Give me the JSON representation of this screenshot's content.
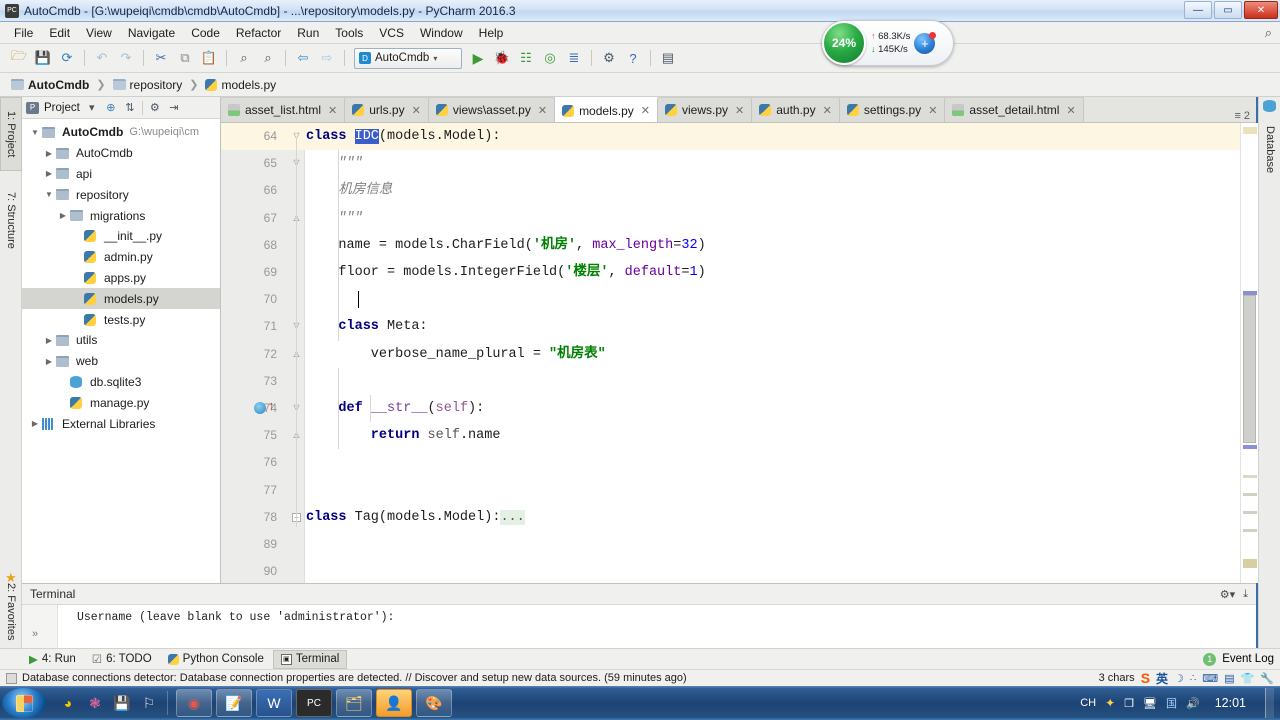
{
  "window": {
    "title": "AutoCmdb - [G:\\wupeiqi\\cmdb\\cmdb\\AutoCmdb] - ...\\repository\\models.py - PyCharm 2016.3",
    "app_icon": "pycharm-icon",
    "minimize_label": "—",
    "maximize_label": "▭",
    "close_label": "✕"
  },
  "menubar": {
    "items": [
      "File",
      "Edit",
      "View",
      "Navigate",
      "Code",
      "Refactor",
      "Run",
      "Tools",
      "VCS",
      "Window",
      "Help"
    ],
    "search_icon": "⌕"
  },
  "toolbar": {
    "buttons": [
      {
        "name": "open-folder-icon",
        "glyph": "🗁",
        "dim": false
      },
      {
        "name": "save-all-icon",
        "glyph": "💾",
        "dim": false
      },
      {
        "name": "sync-icon",
        "glyph": "⟳",
        "dim": false
      },
      {
        "name": "undo-icon",
        "glyph": "↶",
        "dim": true
      },
      {
        "name": "redo-icon",
        "glyph": "↷",
        "dim": true
      },
      {
        "name": "cut-icon",
        "glyph": "✂",
        "dim": false
      },
      {
        "name": "copy-icon",
        "glyph": "⧉",
        "dim": false
      },
      {
        "name": "paste-icon",
        "glyph": "📋",
        "dim": false
      },
      {
        "name": "find-icon",
        "glyph": "⌕",
        "dim": false
      },
      {
        "name": "replace-icon",
        "glyph": "⌕",
        "dim": false
      },
      {
        "name": "back-icon",
        "glyph": "⇦",
        "dim": false
      },
      {
        "name": "forward-icon",
        "glyph": "⇨",
        "dim": true
      }
    ],
    "run_config": {
      "label": "AutoCmdb",
      "icon": "django-icon",
      "caret": "▾"
    },
    "run_buttons": [
      {
        "name": "run-icon",
        "glyph": "▶",
        "color": "#3a9a36"
      },
      {
        "name": "debug-icon",
        "glyph": "🐞",
        "color": "#3a9a36"
      },
      {
        "name": "coverage-icon",
        "glyph": "☲",
        "color": "#3a9a36"
      },
      {
        "name": "profile-icon",
        "glyph": "◎",
        "color": "#3a9a36"
      },
      {
        "name": "attach-icon",
        "glyph": "≣",
        "color": "#2f6fae"
      },
      {
        "name": "settings-icon",
        "glyph": "⚙",
        "color": "#4a5a68"
      },
      {
        "name": "help-icon",
        "glyph": "?",
        "color": "#2f6fae"
      },
      {
        "name": "db-console-icon",
        "glyph": "▤",
        "color": "#4a5a68"
      }
    ]
  },
  "breadcrumb": {
    "items": [
      {
        "label": "AutoCmdb",
        "icon": "folder-icon",
        "bold": true
      },
      {
        "label": "repository",
        "icon": "folder-icon",
        "bold": false
      },
      {
        "label": "models.py",
        "icon": "python-file-icon",
        "bold": false
      }
    ],
    "separator": "❯"
  },
  "left_tool_tabs": [
    {
      "label": "1: Project",
      "selected": true,
      "icon": "project-icon"
    },
    {
      "label": "7: Structure",
      "selected": false,
      "icon": "structure-icon"
    },
    {
      "label": "2: Favorites",
      "selected": false,
      "icon": "star-icon"
    }
  ],
  "right_tool_tabs": [
    {
      "label": "Database",
      "selected": false,
      "icon": "database-icon"
    }
  ],
  "project_panel": {
    "header": {
      "title": "Project",
      "caret": "▾",
      "buttons": [
        "⊕",
        "⇵",
        "⚙",
        "⇥"
      ]
    },
    "tree": [
      {
        "indent": 0,
        "arrow": "▼",
        "icon": "folder-icon",
        "label": "AutoCmdb",
        "bold": true,
        "path": "G:\\wupeiqi\\cm",
        "selected": false
      },
      {
        "indent": 1,
        "arrow": "▶",
        "icon": "folder-icon",
        "label": "AutoCmdb",
        "bold": false,
        "path": "",
        "selected": false
      },
      {
        "indent": 1,
        "arrow": "▶",
        "icon": "folder-icon",
        "label": "api",
        "bold": false,
        "path": "",
        "selected": false
      },
      {
        "indent": 1,
        "arrow": "▼",
        "icon": "folder-icon",
        "label": "repository",
        "bold": false,
        "path": "",
        "selected": false
      },
      {
        "indent": 2,
        "arrow": "▶",
        "icon": "folder-icon",
        "label": "migrations",
        "bold": false,
        "path": "",
        "selected": false
      },
      {
        "indent": 3,
        "arrow": "",
        "icon": "python-file-icon",
        "label": "__init__.py",
        "bold": false,
        "path": "",
        "selected": false
      },
      {
        "indent": 3,
        "arrow": "",
        "icon": "python-file-icon",
        "label": "admin.py",
        "bold": false,
        "path": "",
        "selected": false
      },
      {
        "indent": 3,
        "arrow": "",
        "icon": "python-file-icon",
        "label": "apps.py",
        "bold": false,
        "path": "",
        "selected": false
      },
      {
        "indent": 3,
        "arrow": "",
        "icon": "python-file-icon",
        "label": "models.py",
        "bold": false,
        "path": "",
        "selected": true
      },
      {
        "indent": 3,
        "arrow": "",
        "icon": "python-file-icon",
        "label": "tests.py",
        "bold": false,
        "path": "",
        "selected": false
      },
      {
        "indent": 1,
        "arrow": "▶",
        "icon": "folder-icon",
        "label": "utils",
        "bold": false,
        "path": "",
        "selected": false
      },
      {
        "indent": 1,
        "arrow": "▶",
        "icon": "folder-icon",
        "label": "web",
        "bold": false,
        "path": "",
        "selected": false
      },
      {
        "indent": 2,
        "arrow": "",
        "icon": "database-file-icon",
        "label": "db.sqlite3",
        "bold": false,
        "path": "",
        "selected": false
      },
      {
        "indent": 2,
        "arrow": "",
        "icon": "python-file-icon",
        "label": "manage.py",
        "bold": false,
        "path": "",
        "selected": false
      },
      {
        "indent": 0,
        "arrow": "▶",
        "icon": "library-icon",
        "label": "External Libraries",
        "bold": false,
        "path": "",
        "selected": false
      }
    ]
  },
  "editor_tabs": {
    "tabs": [
      {
        "label": "asset_list.html",
        "icon": "html-file-icon",
        "active": false,
        "close": "✕"
      },
      {
        "label": "urls.py",
        "icon": "python-file-icon",
        "active": false,
        "close": "✕"
      },
      {
        "label": "views\\asset.py",
        "icon": "python-file-icon",
        "active": false,
        "close": "✕"
      },
      {
        "label": "models.py",
        "icon": "python-file-icon",
        "active": true,
        "close": "✕"
      },
      {
        "label": "views.py",
        "icon": "python-file-icon",
        "active": false,
        "close": "✕"
      },
      {
        "label": "auth.py",
        "icon": "python-file-icon",
        "active": false,
        "close": "✕"
      },
      {
        "label": "settings.py",
        "icon": "python-file-icon",
        "active": false,
        "close": "✕"
      },
      {
        "label": "asset_detail.html",
        "icon": "html-file-icon",
        "active": false,
        "close": "✕"
      }
    ],
    "overflow": {
      "icon": "tab-list-icon",
      "glyph": "≡",
      "count": "2"
    }
  },
  "editor": {
    "lines": [
      {
        "num": "64",
        "current": true,
        "fold": "open",
        "tokens": [
          {
            "t": "class ",
            "c": "kw"
          },
          {
            "t": "IDC",
            "c": "sel-text"
          },
          {
            "t": "(models.Model):",
            "c": ""
          }
        ]
      },
      {
        "num": "65",
        "current": false,
        "fold": "open",
        "tokens": [
          {
            "t": "    \"\"\"",
            "c": "cmt"
          }
        ]
      },
      {
        "num": "66",
        "current": false,
        "fold": "",
        "tokens": [
          {
            "t": "    机房信息",
            "c": "cmt"
          }
        ]
      },
      {
        "num": "67",
        "current": false,
        "fold": "close",
        "tokens": [
          {
            "t": "    \"\"\"",
            "c": "cmt"
          }
        ]
      },
      {
        "num": "68",
        "current": false,
        "fold": "",
        "tokens": [
          {
            "t": "    name = models.CharField(",
            "c": ""
          },
          {
            "t": "'机房'",
            "c": "str"
          },
          {
            "t": ", ",
            "c": ""
          },
          {
            "t": "max_length",
            "c": "kwarg"
          },
          {
            "t": "=",
            "c": ""
          },
          {
            "t": "32",
            "c": "num"
          },
          {
            "t": ")",
            "c": ""
          }
        ]
      },
      {
        "num": "69",
        "current": false,
        "fold": "",
        "tokens": [
          {
            "t": "    floor = models.IntegerField(",
            "c": ""
          },
          {
            "t": "'楼层'",
            "c": "str"
          },
          {
            "t": ", ",
            "c": ""
          },
          {
            "t": "default",
            "c": "kwarg"
          },
          {
            "t": "=",
            "c": ""
          },
          {
            "t": "1",
            "c": "num"
          },
          {
            "t": ")",
            "c": ""
          }
        ]
      },
      {
        "num": "70",
        "current": false,
        "fold": "",
        "tokens": []
      },
      {
        "num": "71",
        "current": false,
        "fold": "open",
        "tokens": [
          {
            "t": "    class ",
            "c": "kw"
          },
          {
            "t": "Meta:",
            "c": ""
          }
        ]
      },
      {
        "num": "72",
        "current": false,
        "fold": "close",
        "tokens": [
          {
            "t": "        verbose_name_plural = ",
            "c": ""
          },
          {
            "t": "\"机房表\"",
            "c": "str"
          }
        ]
      },
      {
        "num": "73",
        "current": false,
        "fold": "",
        "tokens": []
      },
      {
        "num": "74",
        "current": false,
        "fold": "open",
        "marker": "override",
        "tokens": [
          {
            "t": "    def ",
            "c": "kw"
          },
          {
            "t": "__str__",
            "c": "fn"
          },
          {
            "t": "(",
            "c": ""
          },
          {
            "t": "self",
            "c": "self"
          },
          {
            "t": "):",
            "c": ""
          }
        ]
      },
      {
        "num": "75",
        "current": false,
        "fold": "close",
        "tokens": [
          {
            "t": "        return ",
            "c": "kw"
          },
          {
            "t": "self",
            "c": "dim-id"
          },
          {
            "t": ".name",
            "c": ""
          }
        ]
      },
      {
        "num": "76",
        "current": false,
        "fold": "",
        "tokens": []
      },
      {
        "num": "77",
        "current": false,
        "fold": "",
        "tokens": []
      },
      {
        "num": "78",
        "current": false,
        "fold": "plus",
        "tokens": [
          {
            "t": "class ",
            "c": "kw"
          },
          {
            "t": "Tag(models.Model):",
            "c": ""
          },
          {
            "t": "...",
            "c": "folded"
          }
        ]
      },
      {
        "num": "89",
        "current": false,
        "fold": "",
        "tokens": []
      },
      {
        "num": "90",
        "current": false,
        "fold": "",
        "tokens": []
      }
    ],
    "gutter_marker_tooltip": "override-method-marker"
  },
  "terminal": {
    "title": "Terminal",
    "prompt_glyph": "»",
    "output": "Username (leave blank to use 'administrator'):",
    "tools": [
      "⚙▾",
      "⤓"
    ]
  },
  "bottom_bar": {
    "buttons": [
      {
        "label": "4: Run",
        "icon": "run-icon",
        "selected": false
      },
      {
        "label": "6: TODO",
        "icon": "todo-icon",
        "selected": false
      },
      {
        "label": "Python Console",
        "icon": "python-console-icon",
        "selected": false
      },
      {
        "label": "Terminal",
        "icon": "terminal-icon",
        "selected": true
      }
    ],
    "event_log": {
      "label": "Event Log",
      "badge": "1"
    }
  },
  "statusbar": {
    "message": "Database connections detector: Database connection properties are detected. // Discover and setup new data sources. (59 minutes ago)",
    "chars": "3 chars",
    "tray": [
      "sogou-logo",
      "英",
      "☽",
      "∴",
      "⌨",
      "⌨",
      "👕",
      "🔧"
    ]
  },
  "taskbar": {
    "start_label": "start-orb",
    "quick_launch": [
      {
        "name": "media-player-icon",
        "glyph": "●"
      },
      {
        "name": "paint-icon",
        "glyph": "❃"
      },
      {
        "name": "save-icon",
        "glyph": "💾"
      },
      {
        "name": "tool-icon",
        "glyph": "⚒"
      }
    ],
    "task_buttons": [
      {
        "name": "chrome-taskbar-button",
        "glyph": "◉",
        "active": false
      },
      {
        "name": "notepad-taskbar-button",
        "glyph": "📝",
        "active": false
      },
      {
        "name": "word-taskbar-button",
        "glyph": "W",
        "active": false
      },
      {
        "name": "pycharm-taskbar-button",
        "glyph": "PC",
        "active": false
      },
      {
        "name": "explorer-taskbar-button",
        "glyph": "🗂",
        "active": false
      },
      {
        "name": "app-taskbar-button",
        "glyph": "👤",
        "active": true
      },
      {
        "name": "paint-taskbar-button",
        "glyph": "🎨",
        "active": false
      }
    ],
    "tray_icons": [
      {
        "name": "shield-icon",
        "glyph": "✦"
      },
      {
        "name": "windows-icon",
        "glyph": "❐"
      },
      {
        "name": "network-icon",
        "glyph": "🖥"
      },
      {
        "name": "input-method-icon",
        "glyph": "国"
      },
      {
        "name": "volume-icon",
        "glyph": "🔊"
      }
    ],
    "language_indicator": "CH",
    "clock": "12:01"
  },
  "net_widget": {
    "cpu_percent": "24%",
    "upload": "68.3K/s",
    "download": "145K/s",
    "up_arrow": "↑",
    "down_arrow": "↓",
    "plus_label": "+"
  }
}
